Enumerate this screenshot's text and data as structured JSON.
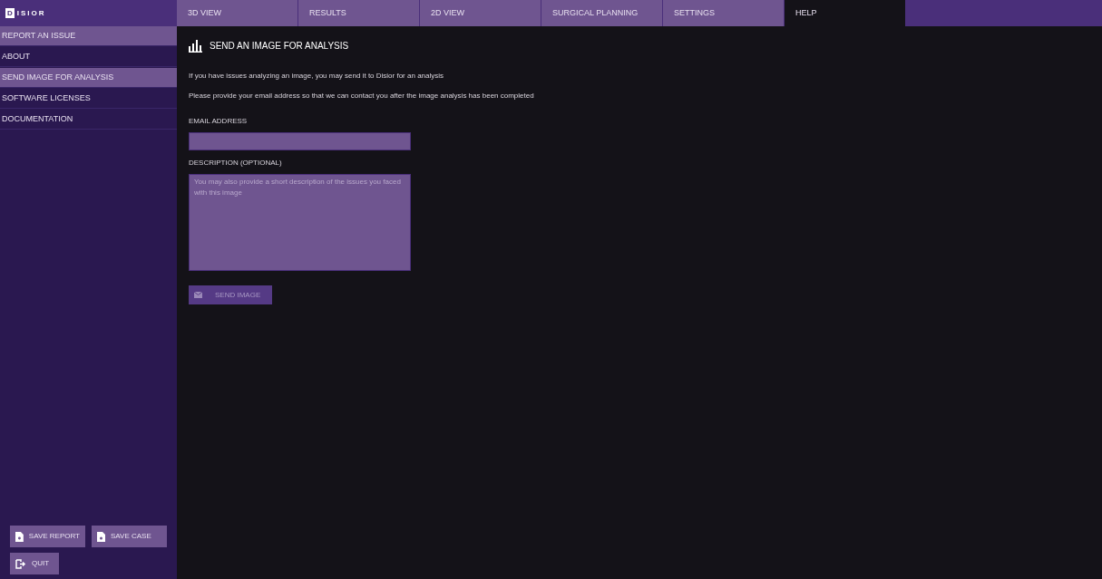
{
  "logo": {
    "mark": "D",
    "text": "ISIOR"
  },
  "tabs": [
    {
      "label": "3D VIEW",
      "selected": false
    },
    {
      "label": "RESULTS",
      "selected": false
    },
    {
      "label": "2D VIEW",
      "selected": false
    },
    {
      "label": "SURGICAL PLANNING",
      "selected": false
    },
    {
      "label": "SETTINGS",
      "selected": false
    },
    {
      "label": "HELP",
      "selected": true
    }
  ],
  "sidebar": {
    "items": [
      {
        "label": "REPORT AN ISSUE",
        "kind": "header"
      },
      {
        "label": "ABOUT",
        "kind": "item",
        "selected": false
      },
      {
        "label": "SEND IMAGE FOR ANALYSIS",
        "kind": "item",
        "selected": true
      },
      {
        "label": "SOFTWARE LICENSES",
        "kind": "item",
        "selected": false
      },
      {
        "label": "DOCUMENTATION",
        "kind": "item",
        "selected": false
      }
    ],
    "buttons": [
      {
        "label": "SAVE REPORT",
        "kind": "file"
      },
      {
        "label": "SAVE CASE",
        "kind": "file"
      },
      {
        "label": "QUIT",
        "kind": "exit"
      }
    ]
  },
  "panel": {
    "title": "SEND AN IMAGE FOR ANALYSIS",
    "paragraphs": [
      "If you have issues analyzing an image, you may send it to Disior for an analysis",
      "Please provide your email address so that we can contact you after the image analysis has been completed"
    ],
    "email": {
      "label": "EMAIL ADDRESS"
    },
    "description": {
      "label": "DESCRIPTION (OPTIONAL)",
      "placeholder": "You may also provide a short description of the issues you faced with this image"
    },
    "send_button": {
      "label": "SEND IMAGE",
      "disabled": true
    }
  }
}
